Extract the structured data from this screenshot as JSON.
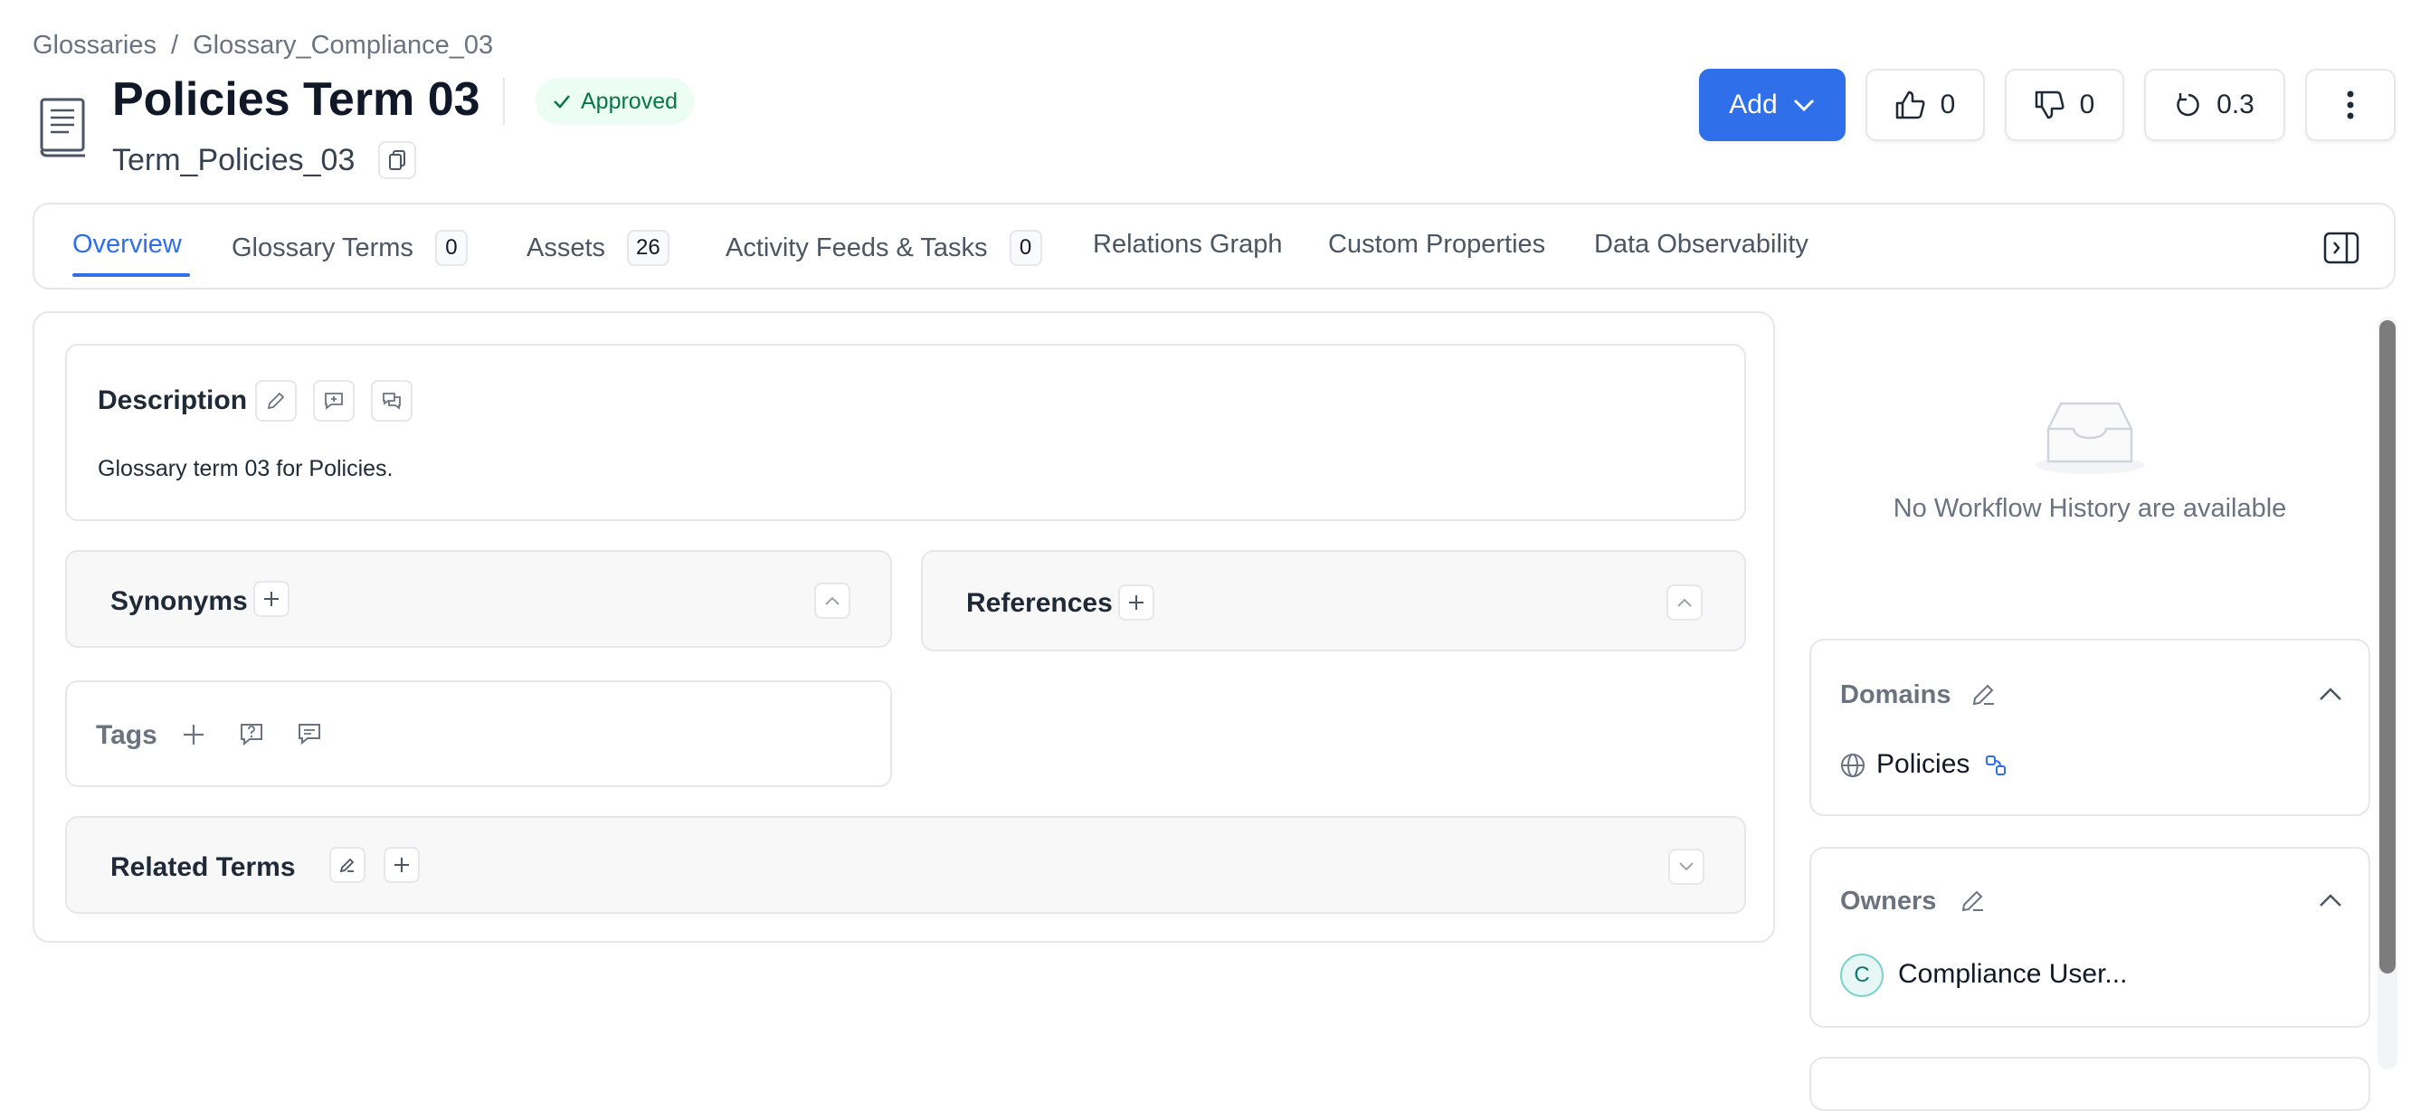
{
  "breadcrumb": {
    "root": "Glossaries",
    "separator": "/",
    "current": "Glossary_Compliance_03"
  },
  "header": {
    "title": "Policies Term 03",
    "status": "Approved",
    "fqn": "Term_Policies_03"
  },
  "actions": {
    "add_label": "Add",
    "likes": "0",
    "dislikes": "0",
    "version": "0.3"
  },
  "tabs": [
    {
      "label": "Overview",
      "active": true
    },
    {
      "label": "Glossary Terms",
      "count": "0"
    },
    {
      "label": "Assets",
      "count": "26"
    },
    {
      "label": "Activity Feeds & Tasks",
      "count": "0"
    },
    {
      "label": "Relations Graph"
    },
    {
      "label": "Custom Properties"
    },
    {
      "label": "Data Observability"
    }
  ],
  "overview": {
    "description_title": "Description",
    "description_text": "Glossary term 03 for Policies.",
    "synonyms_title": "Synonyms",
    "references_title": "References",
    "tags_title": "Tags",
    "related_terms_title": "Related Terms"
  },
  "side_panel": {
    "workflow_empty": "No Workflow History are available",
    "domains_title": "Domains",
    "domain_name": "Policies",
    "owners_title": "Owners",
    "owner_initial": "C",
    "owner_name": "Compliance User..."
  },
  "colors": {
    "accent": "#2f6fea",
    "approved_bg": "#ecfdf3",
    "approved_text": "#067647"
  }
}
